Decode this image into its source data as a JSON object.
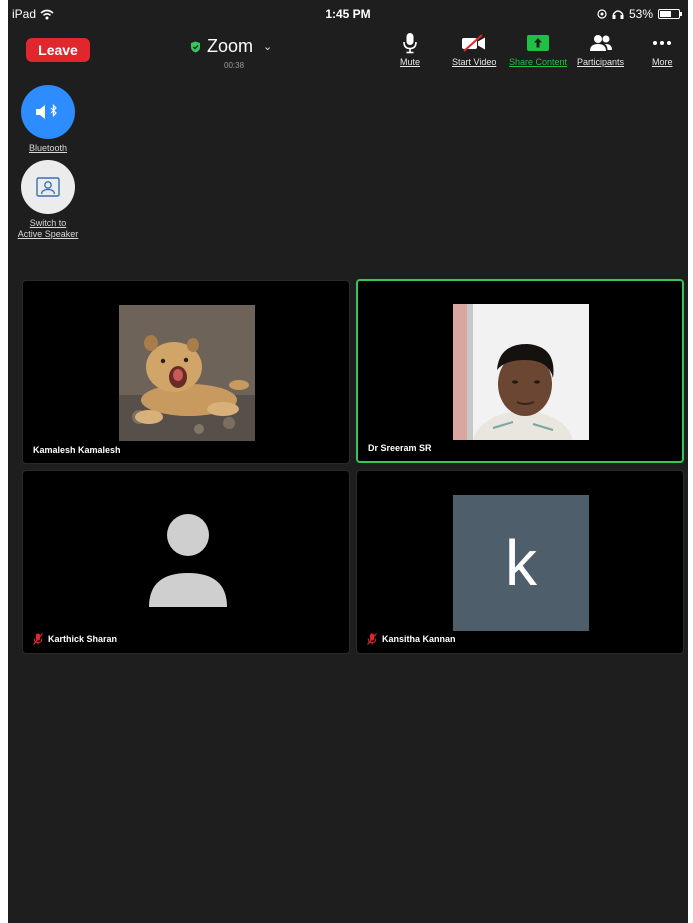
{
  "status_bar": {
    "device": "iPad",
    "time": "1:45 PM",
    "battery": "53%"
  },
  "meeting": {
    "leave_label": "Leave",
    "title": "Zoom",
    "timer": "00:38"
  },
  "toolbar": {
    "mute_label": "Mute",
    "start_video_label": "Start Video",
    "share_label": "Share Content",
    "participants_label": "Participants",
    "more_label": "More"
  },
  "side_controls": {
    "bluetooth_label": "Bluetooth",
    "switch_line1": "Switch to",
    "switch_line2": "Active Speaker"
  },
  "participants": [
    {
      "name": "Kamalesh Kamalesh",
      "muted": false,
      "video": "lion-cub-photo"
    },
    {
      "name": "Dr Sreeram SR",
      "muted": false,
      "video": "camera-feed",
      "active_speaker": true
    },
    {
      "name": "Karthick Sharan",
      "muted": true,
      "video": "default-avatar"
    },
    {
      "name": "Kansitha Kannan",
      "muted": true,
      "video": "letter-avatar",
      "avatar_letter": "k"
    }
  ],
  "colors": {
    "leave": "#e0272e",
    "share_green": "#1fc145",
    "active_border": "#35c759",
    "bluetooth_blue": "#2d8cff",
    "letter_avatar_bg": "#4f5e6b"
  }
}
